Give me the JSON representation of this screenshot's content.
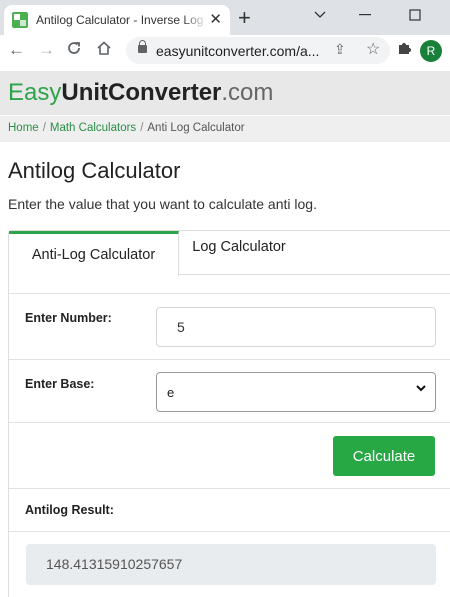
{
  "browser": {
    "tab_title": "Antilog Calculator - Inverse Log Calculator",
    "tab_close": "✕",
    "new_tab": "+",
    "url": "easyunitconverter.com/a...",
    "profile_initial": "R"
  },
  "site": {
    "logo_part1": "Easy",
    "logo_part2": "UnitConverter",
    "logo_part3": ".com"
  },
  "breadcrumb": {
    "home": "Home",
    "category": "Math Calculators",
    "current": "Anti Log Calculator",
    "separator": "/"
  },
  "page": {
    "title": "Antilog Calculator",
    "description": "Enter the value that you want to calculate anti log."
  },
  "calculator": {
    "tabs": [
      {
        "label": "Anti-Log Calculator",
        "active": true
      },
      {
        "label": "Log Calculator",
        "active": false
      }
    ],
    "number_label": "Enter Number:",
    "number_value": "5",
    "base_label": "Enter Base:",
    "base_value": "e",
    "calculate_label": "Calculate",
    "result_label": "Antilog Result:",
    "result_value": "148.41315910257657"
  },
  "colors": {
    "brand_green": "#2ea34a",
    "button_green": "#28a745",
    "header_bg": "#e8e8e8",
    "result_bg": "#e9ecef"
  },
  "icons": {
    "back": "arrow-left-icon",
    "forward": "arrow-right-icon",
    "reload": "reload-icon",
    "home": "home-icon",
    "lock": "lock-icon",
    "share": "share-icon",
    "bookmark": "star-icon",
    "extensions": "puzzle-icon"
  }
}
